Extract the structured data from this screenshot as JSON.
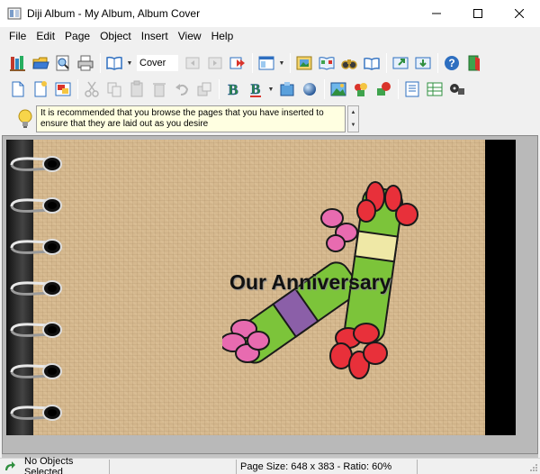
{
  "window": {
    "title": "Diji Album - My Album, Album Cover",
    "controls": [
      "minimize",
      "maximize",
      "close"
    ]
  },
  "menu": {
    "items": [
      "File",
      "Edit",
      "Page",
      "Object",
      "Insert",
      "View",
      "Help"
    ]
  },
  "toolbar1": {
    "page_field_value": "Cover",
    "icons": [
      "library-icon",
      "open-album-icon",
      "print-preview-icon",
      "print-icon",
      "book-view-icon",
      "first-page-icon",
      "next-page-icon",
      "last-page-icon",
      "layout-icon",
      "image-icon",
      "album-page-icon",
      "binoculars-icon",
      "open-book-icon",
      "export-icon",
      "import-icon",
      "help-icon",
      "exit-icon"
    ]
  },
  "toolbar2": {
    "icons": [
      "new-page-icon",
      "new-page-wizard-icon",
      "photo-page-icon",
      "cut-icon",
      "copy-icon",
      "paste-icon",
      "delete-icon",
      "undo-icon",
      "bring-front-icon",
      "text-style-icon",
      "text-effect-icon",
      "shape-icon",
      "sphere-icon",
      "insert-picture-icon",
      "insert-clipart-icon",
      "insert-shapes-icon",
      "list-icon",
      "table-icon",
      "film-icon"
    ]
  },
  "tip": {
    "text": "It is recommended that you browse the pages that you have inserted to ensure that they are laid out as you desire"
  },
  "album": {
    "title_text": "Our Anniversary",
    "ring_count": 7
  },
  "status": {
    "selection": "No Objects Selected",
    "page_info": "Page Size: 648 x 383 - Ratio: 60%"
  },
  "colors": {
    "page_texture": "#d6b98f",
    "cracker_green": "#7cc43a",
    "cracker_purple": "#8b5fa8",
    "cracker_cream": "#efe8a6",
    "flower_pink": "#e86bb0",
    "flower_red": "#e8303a",
    "tip_background": "#ffffe1"
  }
}
